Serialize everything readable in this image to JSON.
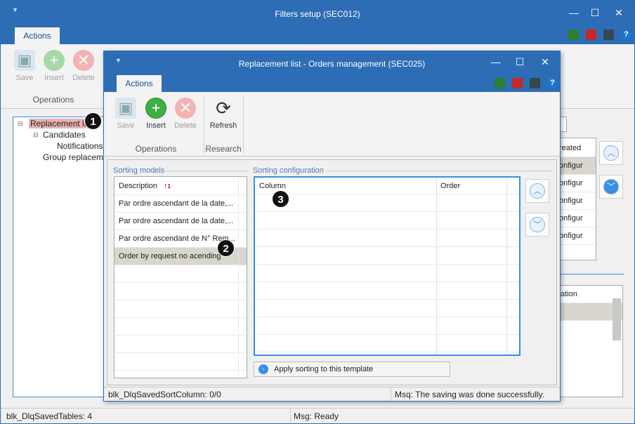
{
  "outer": {
    "title": "Filters setup (SEC012)",
    "tab_actions": "Actions",
    "save_label": "Save",
    "insert_label": "Insert",
    "delete_label": "Delete",
    "group_operations": "Operations",
    "tree": [
      "Replacement lis",
      "Candidates",
      "Notifications",
      "Group replacemen"
    ],
    "right_grid_header": "reated",
    "right_grid_rows": [
      "onfigur",
      "onfigur",
      "onfigur",
      "onfigur",
      "onfigur"
    ],
    "right_grid2_header": "ation",
    "status_left": "blk_DlqSavedTables: 4",
    "status_right": "Msg: Ready"
  },
  "inner": {
    "title": "Replacement list - Orders management (SEC025)",
    "tab_actions": "Actions",
    "save_label": "Save",
    "insert_label": "Insert",
    "delete_label": "Delete",
    "refresh_label": "Refresh",
    "group_operations": "Operations",
    "group_research": "Research",
    "sorting_models_label": "Sorting models",
    "sorting_config_label": "Sorting configuration",
    "models_header": "Description",
    "sort_indicator": "1",
    "models_rows": [
      "Par ordre ascendant de la date,...",
      "Par ordre ascendant de la date,...",
      "Par ordre ascendant de N° Rem...",
      "Order by request no acending"
    ],
    "config_headers": [
      "Column",
      "Order"
    ],
    "apply_label": "Apply sorting to this template",
    "status_left": "blk_DlqSavedSortColumn: 0/0",
    "status_right": "Msq: The saving was done successfully."
  },
  "markers": [
    "1",
    "2",
    "3"
  ],
  "colors": {
    "titlebar": "#2d6db5",
    "accent": "#3a8ee6",
    "selected_row": "#d9d5cf",
    "highlight_tree": "#e8b4b4"
  }
}
